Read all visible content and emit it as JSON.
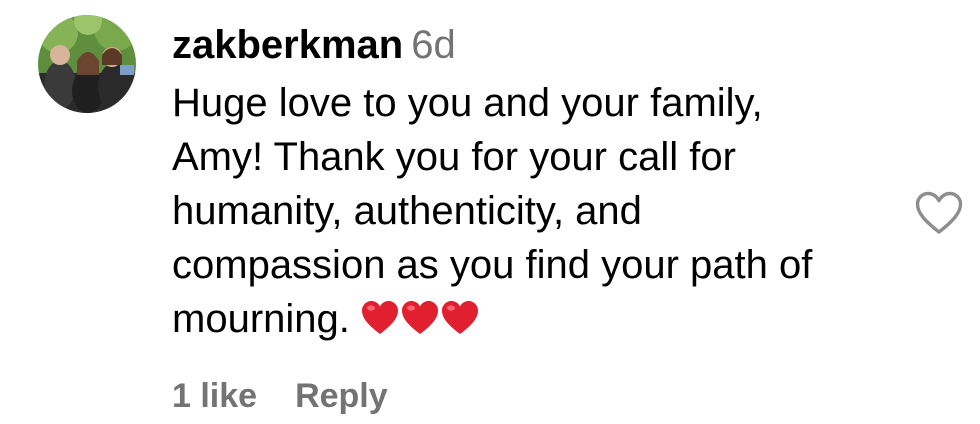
{
  "comment": {
    "username": "zakberkman",
    "timestamp": "6d",
    "text_lines": [
      "Huge love to you and your family,",
      "Amy! Thank you for your call for",
      "humanity, authenticity, and",
      "compassion as you find your path of",
      "mourning."
    ],
    "emoji": "red-heart x3",
    "likes_label": "1 like",
    "reply_label": "Reply"
  },
  "icons": {
    "avatar": "avatar-photo",
    "emoji_heart": "red-heart-emoji",
    "like_button": "heart-outline-icon"
  },
  "colors": {
    "text": "#000000",
    "secondary": "#737373",
    "emoji_red": "#e0202e",
    "icon_gray": "#8e8e8e"
  }
}
